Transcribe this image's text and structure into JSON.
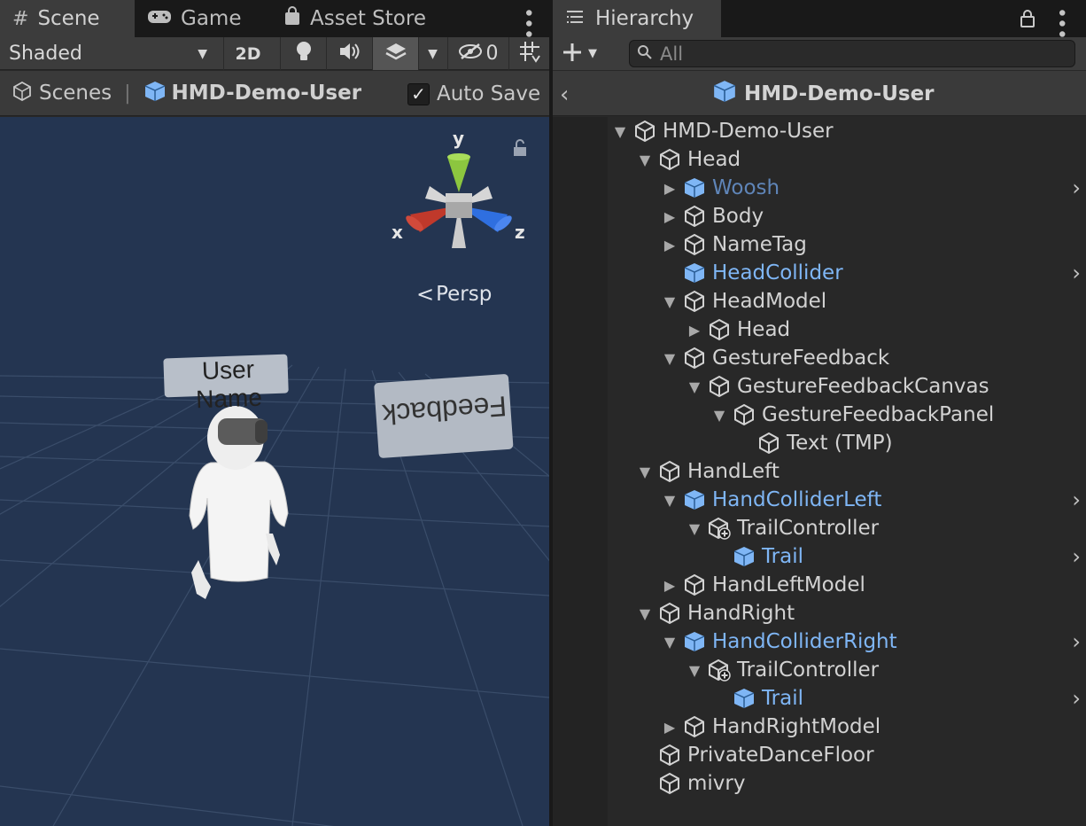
{
  "scene_panel": {
    "tabs": [
      {
        "label": "Scene",
        "icon": "grid-icon"
      },
      {
        "label": "Game",
        "icon": "gamepad-icon"
      },
      {
        "label": "Asset Store",
        "icon": "shopping-bag-icon"
      }
    ],
    "toolbar": {
      "draw_mode": "Shaded",
      "mode_2d": "2D",
      "hidden_count": "0"
    },
    "breadcrumb": {
      "scenes_label": "Scenes",
      "prefab_name": "HMD-Demo-User",
      "auto_save_label": "Auto Save",
      "auto_save_checked": true
    },
    "viewport": {
      "gizmo_axes": {
        "y": "y",
        "x": "x",
        "z": "z"
      },
      "projection_label": "Persp",
      "user_name_tag": "User Name",
      "feedback_panel": "Feedback",
      "background_color": "#243551",
      "grid_color": "#3a4d6a"
    }
  },
  "hierarchy_panel": {
    "tab_label": "Hierarchy",
    "search_placeholder": "All",
    "header_title": "HMD-Demo-User",
    "items": [
      {
        "label": "HMD-Demo-User",
        "depth": 0,
        "arrow": "expanded",
        "icon": "gameobject-icon",
        "style": "normal",
        "has_chevron": false
      },
      {
        "label": "Head",
        "depth": 1,
        "arrow": "expanded",
        "icon": "gameobject-icon",
        "style": "normal",
        "has_chevron": false
      },
      {
        "label": "Woosh",
        "depth": 2,
        "arrow": "collapsed",
        "icon": "prefab-icon",
        "style": "inactive",
        "has_chevron": true
      },
      {
        "label": "Body",
        "depth": 2,
        "arrow": "collapsed",
        "icon": "gameobject-icon",
        "style": "normal",
        "has_chevron": false
      },
      {
        "label": "NameTag",
        "depth": 2,
        "arrow": "collapsed",
        "icon": "gameobject-icon",
        "style": "normal",
        "has_chevron": false
      },
      {
        "label": "HeadCollider",
        "depth": 2,
        "arrow": "none",
        "icon": "prefab-icon",
        "style": "prefab",
        "has_chevron": true
      },
      {
        "label": "HeadModel",
        "depth": 2,
        "arrow": "expanded",
        "icon": "gameobject-icon",
        "style": "normal",
        "has_chevron": false
      },
      {
        "label": "Head",
        "depth": 3,
        "arrow": "collapsed",
        "icon": "gameobject-icon",
        "style": "normal",
        "has_chevron": false
      },
      {
        "label": "GestureFeedback",
        "depth": 2,
        "arrow": "expanded",
        "icon": "gameobject-icon",
        "style": "normal",
        "has_chevron": false
      },
      {
        "label": "GestureFeedbackCanvas",
        "depth": 3,
        "arrow": "expanded",
        "icon": "gameobject-icon",
        "style": "normal",
        "has_chevron": false
      },
      {
        "label": "GestureFeedbackPanel",
        "depth": 4,
        "arrow": "expanded",
        "icon": "gameobject-icon",
        "style": "normal",
        "has_chevron": false
      },
      {
        "label": "Text (TMP)",
        "depth": 5,
        "arrow": "none",
        "icon": "gameobject-icon",
        "style": "normal",
        "has_chevron": false
      },
      {
        "label": "HandLeft",
        "depth": 1,
        "arrow": "expanded",
        "icon": "gameobject-icon",
        "style": "normal",
        "has_chevron": false
      },
      {
        "label": "HandColliderLeft",
        "depth": 2,
        "arrow": "expanded",
        "icon": "prefab-icon",
        "style": "prefab",
        "has_chevron": true
      },
      {
        "label": "TrailController",
        "depth": 3,
        "arrow": "expanded",
        "icon": "gameobject-added-icon",
        "style": "normal",
        "has_chevron": false
      },
      {
        "label": "Trail",
        "depth": 4,
        "arrow": "none",
        "icon": "prefab-icon",
        "style": "prefab",
        "has_chevron": true
      },
      {
        "label": "HandLeftModel",
        "depth": 2,
        "arrow": "collapsed",
        "icon": "gameobject-icon",
        "style": "normal",
        "has_chevron": false
      },
      {
        "label": "HandRight",
        "depth": 1,
        "arrow": "expanded",
        "icon": "gameobject-icon",
        "style": "normal",
        "has_chevron": false
      },
      {
        "label": "HandColliderRight",
        "depth": 2,
        "arrow": "expanded",
        "icon": "prefab-icon",
        "style": "prefab",
        "has_chevron": true
      },
      {
        "label": "TrailController",
        "depth": 3,
        "arrow": "expanded",
        "icon": "gameobject-added-icon",
        "style": "normal",
        "has_chevron": false
      },
      {
        "label": "Trail",
        "depth": 4,
        "arrow": "none",
        "icon": "prefab-icon",
        "style": "prefab",
        "has_chevron": true
      },
      {
        "label": "HandRightModel",
        "depth": 2,
        "arrow": "collapsed",
        "icon": "gameobject-icon",
        "style": "normal",
        "has_chevron": false
      },
      {
        "label": "PrivateDanceFloor",
        "depth": 1,
        "arrow": "none",
        "icon": "gameobject-icon",
        "style": "normal",
        "has_chevron": false
      },
      {
        "label": "mivry",
        "depth": 1,
        "arrow": "none",
        "icon": "gameobject-icon",
        "style": "normal",
        "has_chevron": false
      }
    ]
  },
  "colors": {
    "prefab_text": "#7fb6f5",
    "inactive_prefab_text": "#5f85b8",
    "gizmo_x": "#c0392b",
    "gizmo_y": "#8cc63f",
    "gizmo_z": "#2f6fe0"
  }
}
